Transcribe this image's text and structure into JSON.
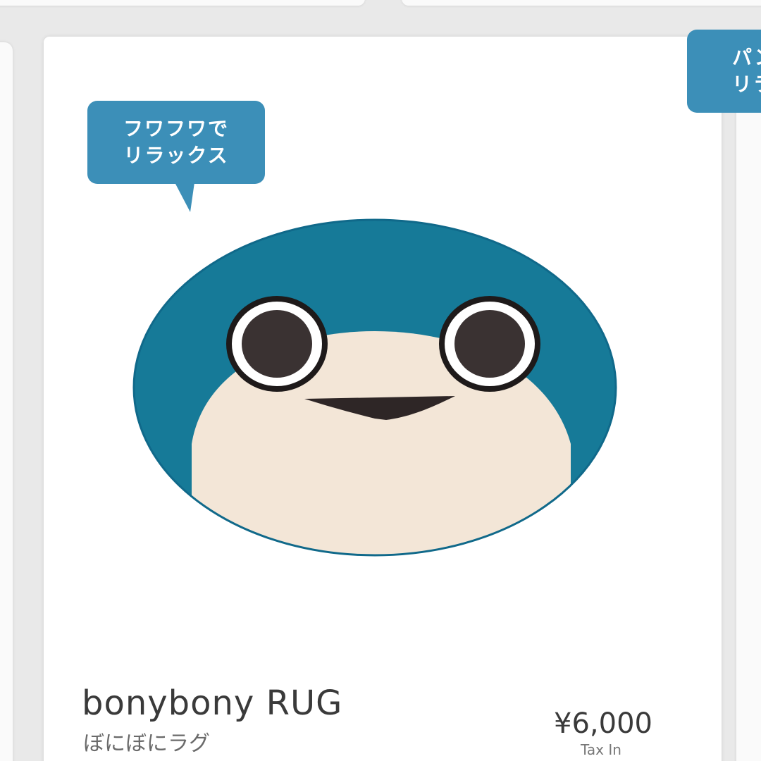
{
  "colors": {
    "accent": "#3c8fb8",
    "rug_blue": "#167a98",
    "rug_cream": "#f3e6d7",
    "eye_dark": "#3a3232",
    "text_dark": "#3a3a3a"
  },
  "badges": {
    "main_line1": "フワフワで",
    "main_line2": "リラックス",
    "side_line1": "パン",
    "side_line2": "リラ"
  },
  "product": {
    "image_icon": "bonybony-rug-face-image",
    "name": "bonybony RUG",
    "name_jp": "ぼにぼにラグ",
    "price": "¥6,000",
    "tax_note": "Tax In"
  }
}
